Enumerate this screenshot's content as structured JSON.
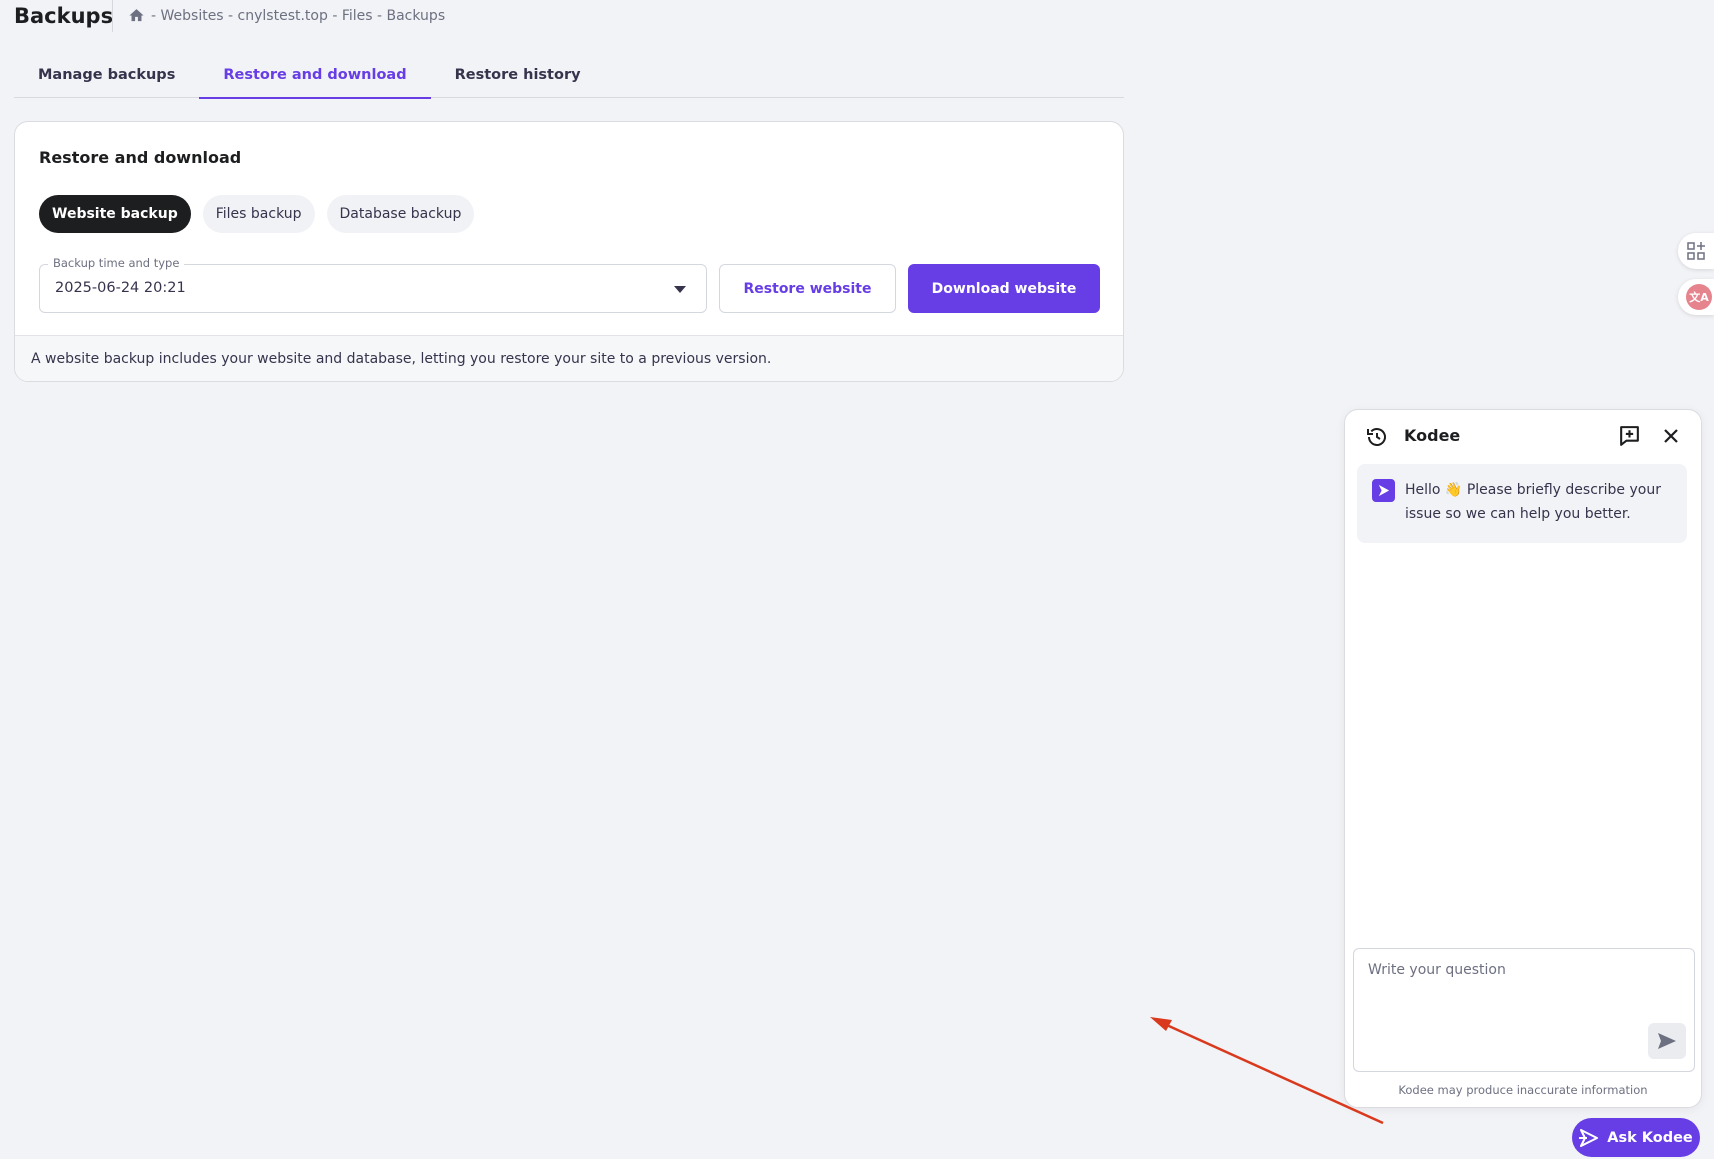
{
  "header": {
    "title": "Backups",
    "breadcrumb": "- Websites - cnylstest.top - Files - Backups"
  },
  "tabs": [
    {
      "label": "Manage backups",
      "active": false
    },
    {
      "label": "Restore and download",
      "active": true
    },
    {
      "label": "Restore history",
      "active": false
    }
  ],
  "card": {
    "title": "Restore and download",
    "chips": [
      {
        "label": "Website backup",
        "active": true
      },
      {
        "label": "Files backup",
        "active": false
      },
      {
        "label": "Database backup",
        "active": false
      }
    ],
    "select": {
      "label": "Backup time and type",
      "value": "2025-06-24 20:21"
    },
    "restore_label": "Restore website",
    "download_label": "Download website",
    "footer": "A website backup includes your website and database, letting you restore your site to a previous version."
  },
  "edge_widgets": {
    "translate_label": "文A"
  },
  "chat": {
    "title": "Kodee",
    "message": "Hello 👋 Please briefly describe your issue so we can help you better.",
    "input_placeholder": "Write your question",
    "disclaimer": "Kodee may produce inaccurate information"
  },
  "ask_kodee": "Ask Kodee",
  "colors": {
    "accent": "#673de6",
    "background": "#f2f3f6",
    "annotation": "#d9391c"
  }
}
